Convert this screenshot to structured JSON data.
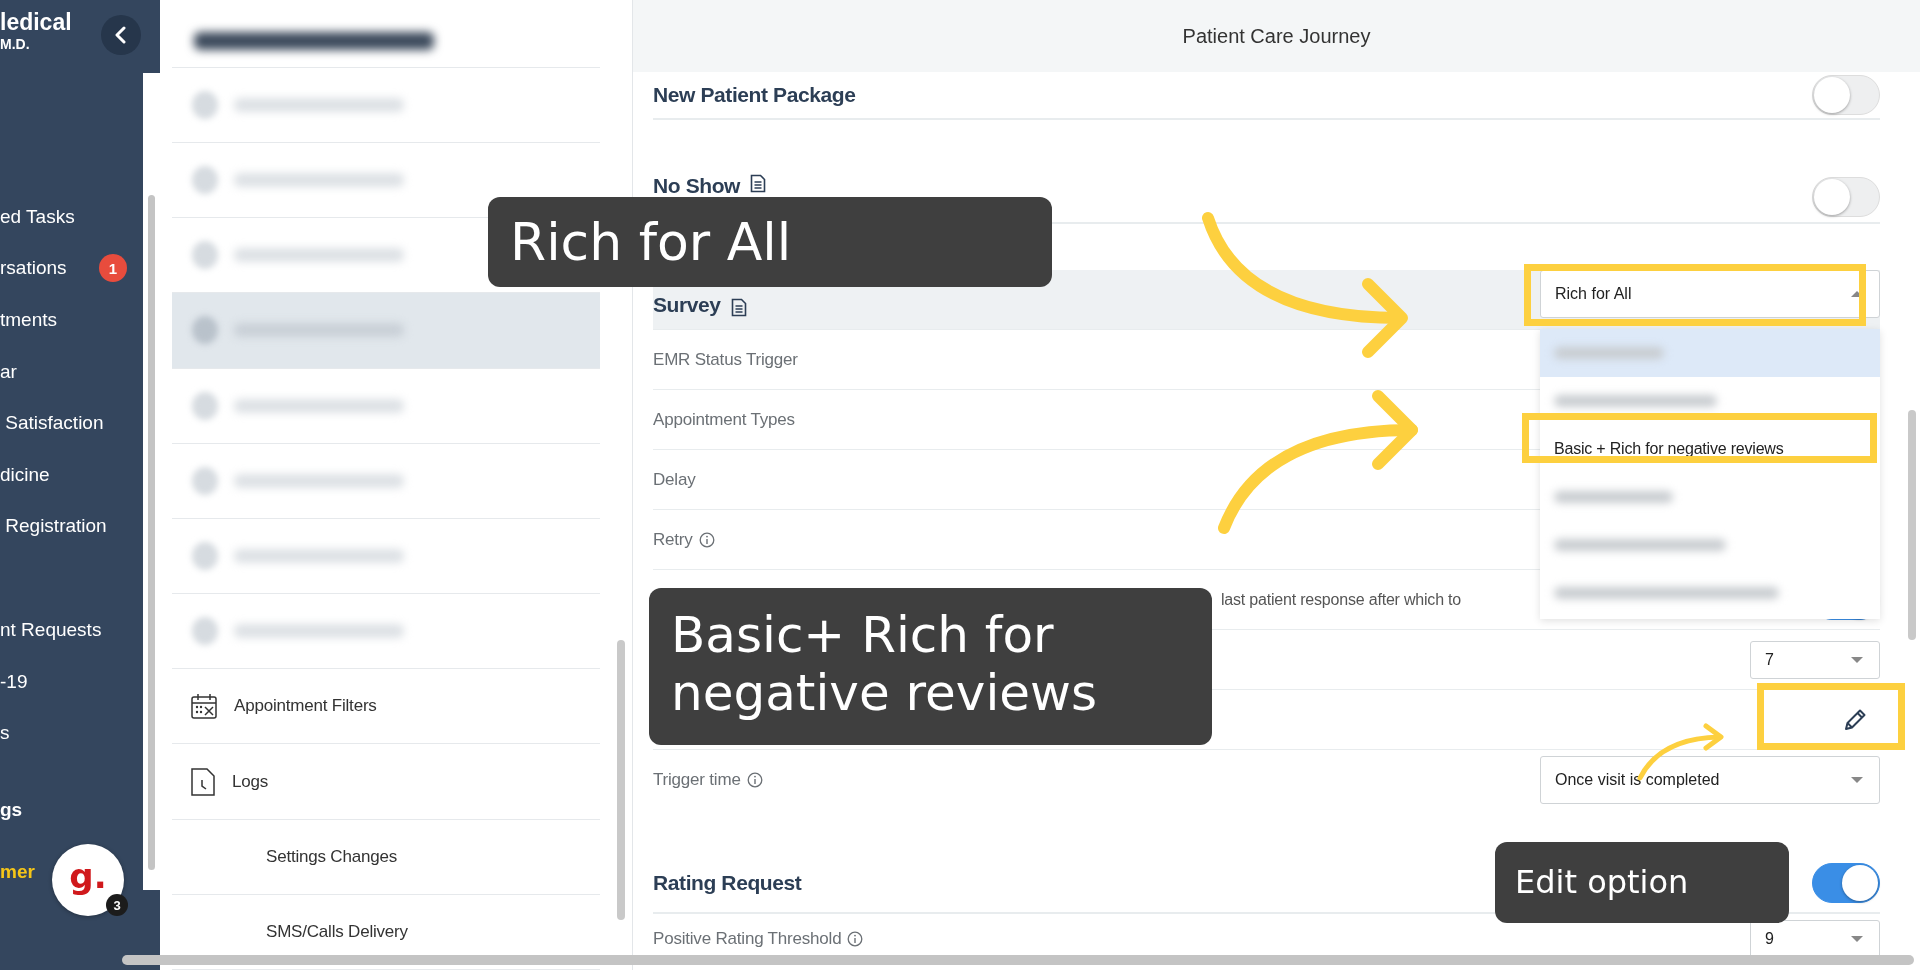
{
  "sidebar": {
    "brand": "ledical",
    "subtitle": "M.D.",
    "groups": [
      [
        {
          "label": "ed Tasks"
        },
        {
          "label": "rsations",
          "badge": "1"
        },
        {
          "label": "tments"
        },
        {
          "label": "ar"
        },
        {
          "label": " Satisfaction"
        },
        {
          "label": "dicine"
        },
        {
          "label": " Registration"
        }
      ],
      [
        {
          "label": "nt Requests"
        },
        {
          "label": "-19"
        },
        {
          "label": "s"
        }
      ]
    ],
    "section_label": "gs",
    "footer_link": "mer",
    "chat_logo": "g.",
    "chat_badge": "3"
  },
  "settings_menu": {
    "items": [
      {
        "kind": "blurred",
        "selected": false
      },
      {
        "kind": "blurred",
        "selected": false
      },
      {
        "kind": "blurred",
        "selected": false
      },
      {
        "kind": "blurred",
        "selected": true
      },
      {
        "kind": "blurred",
        "selected": false
      },
      {
        "kind": "blurred",
        "selected": false
      },
      {
        "kind": "blurred",
        "selected": false
      },
      {
        "kind": "blurred",
        "selected": false
      },
      {
        "kind": "calendar",
        "label": "Appointment Filters",
        "selected": false
      },
      {
        "kind": "document",
        "label": "Logs",
        "selected": false
      },
      {
        "kind": "subitem",
        "label": "Settings Changes",
        "selected": false
      },
      {
        "kind": "subitem",
        "label": "SMS/Calls Delivery",
        "selected": false
      }
    ]
  },
  "panel": {
    "title": "Patient Care Journey",
    "sections": [
      {
        "title": "New Patient Package",
        "doc": false,
        "highlighted": false,
        "kind": "toggle",
        "on": false
      },
      {
        "title": "No Show",
        "doc": true,
        "highlighted": false,
        "kind": "toggle",
        "on": false
      },
      {
        "title": "Survey",
        "doc": true,
        "highlighted": true,
        "kind": "select",
        "value": "Rich for All",
        "open": true,
        "options": [
          {
            "kind": "blurred",
            "hovered": true
          },
          {
            "kind": "blurred",
            "hovered": false
          },
          {
            "kind": "text",
            "label": "Basic + Rich for negative reviews",
            "hovered": false
          },
          {
            "kind": "blurred",
            "hovered": false
          },
          {
            "kind": "blurred",
            "hovered": false
          },
          {
            "kind": "blurred",
            "hovered": false
          }
        ],
        "rows": [
          {
            "label": "EMR Status Trigger",
            "info": false,
            "kind": "plain"
          },
          {
            "label": "Appointment Types",
            "info": false,
            "kind": "plain"
          },
          {
            "label": "Delay",
            "info": false,
            "kind": "plain"
          },
          {
            "label": "Retry",
            "info": true,
            "kind": "plain"
          },
          {
            "kind": "days",
            "note": "last patient response after which to",
            "on": true
          },
          {
            "kind": "small_select",
            "value": "7"
          },
          {
            "kind": "edit"
          },
          {
            "label": "Trigger time",
            "info": true,
            "kind": "select",
            "value": "Once visit is completed"
          }
        ]
      },
      {
        "title": "Rating Request",
        "doc": false,
        "highlighted": false,
        "kind": "toggle",
        "on": true,
        "rows": [
          {
            "label": "Positive Rating Threshold",
            "info": true,
            "kind": "small_select",
            "value": "9"
          }
        ]
      }
    ]
  },
  "annotations": {
    "callouts": [
      {
        "text": "Rich for All"
      },
      {
        "text": "Basic+ Rich for negative reviews"
      },
      {
        "text": "Edit option"
      }
    ]
  }
}
